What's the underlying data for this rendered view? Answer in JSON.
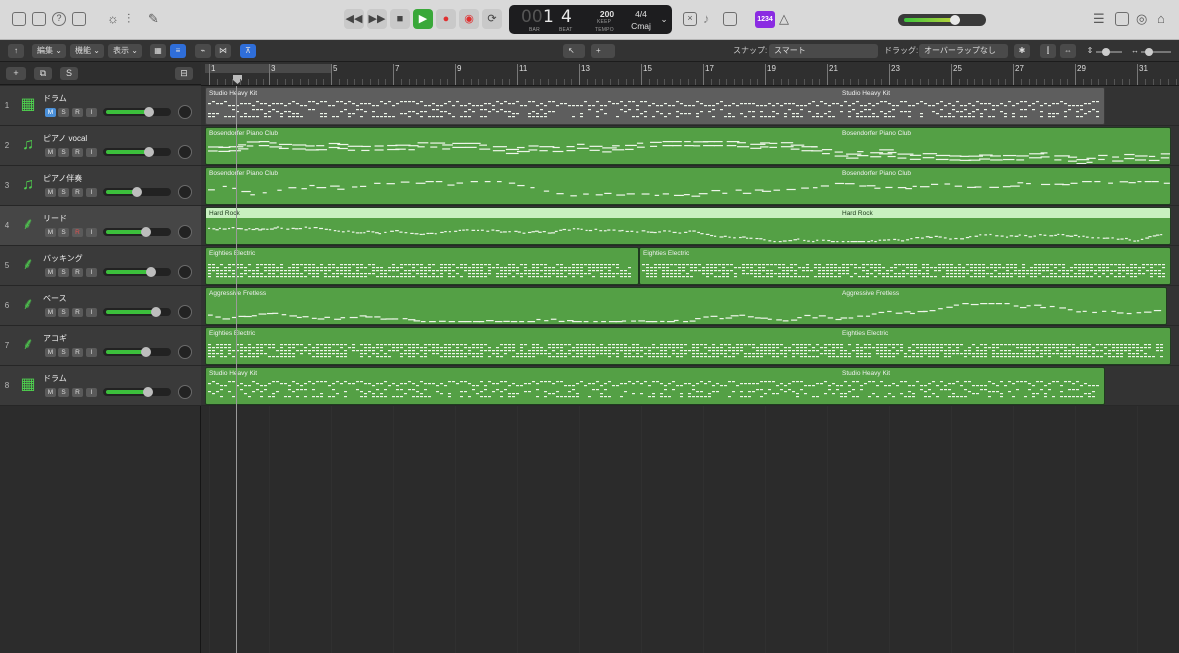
{
  "transport": {
    "bar": "1",
    "beat": "4",
    "bar_label": "BAR",
    "beat_label": "BEAT",
    "tempo": "200",
    "tempo_sub": "KEEP",
    "tempo_label": "TEMPO",
    "signature": "4/4",
    "key": "Cmaj"
  },
  "count_in_badge": "1234",
  "toolbar": {
    "edit": "編集",
    "function": "機能",
    "view": "表示",
    "snap_label": "スナップ:",
    "snap_value": "スマート",
    "drag_label": "ドラッグ:",
    "drag_value": "オーバーラップなし"
  },
  "ruler": [
    "1",
    "3",
    "5",
    "7",
    "9",
    "11",
    "13",
    "15",
    "17",
    "19",
    "21",
    "23",
    "25",
    "27",
    "29",
    "31"
  ],
  "tracks": [
    {
      "num": "1",
      "name": "ドラム",
      "icon": "drum-machine-icon",
      "fader": 0.7
    },
    {
      "num": "2",
      "name": "ピアノ vocal",
      "icon": "piano-icon",
      "fader": 0.7
    },
    {
      "num": "3",
      "name": "ピアノ伴奏",
      "icon": "piano-icon",
      "fader": 0.5
    },
    {
      "num": "4",
      "name": "リード",
      "icon": "guitar-icon",
      "fader": 0.65
    },
    {
      "num": "5",
      "name": "バッキング",
      "icon": "guitar-icon",
      "fader": 0.72
    },
    {
      "num": "6",
      "name": "ベース",
      "icon": "bass-icon",
      "fader": 0.8
    },
    {
      "num": "7",
      "name": "アコギ",
      "icon": "acoustic-guitar-icon",
      "fader": 0.65
    },
    {
      "num": "8",
      "name": "ドラム",
      "icon": "drum-machine-icon",
      "fader": 0.68
    }
  ],
  "msri": {
    "m": "M",
    "s": "S",
    "r": "R",
    "i": "I"
  },
  "regions": [
    {
      "name": "Studio Heavy Kit",
      "name2": "Studio Heavy Kit"
    },
    {
      "name": "Bosendorfer Piano Club",
      "name2": "Bosendorfer Piano Club"
    },
    {
      "name": "Bosendorfer Piano Club",
      "name2": "Bosendorfer Piano Club"
    },
    {
      "name": "Hard Rock",
      "name2": "Hard Rock"
    },
    {
      "name": "Eighties Electric",
      "name2": "Eighties Electric"
    },
    {
      "name": "Aggressive Fretless",
      "name2": "Aggressive Fretless"
    },
    {
      "name": "Eighties Electric",
      "name2": "Eighties Electric"
    },
    {
      "name": "Studio Heavy Kit",
      "name2": "Studio Heavy Kit"
    }
  ]
}
